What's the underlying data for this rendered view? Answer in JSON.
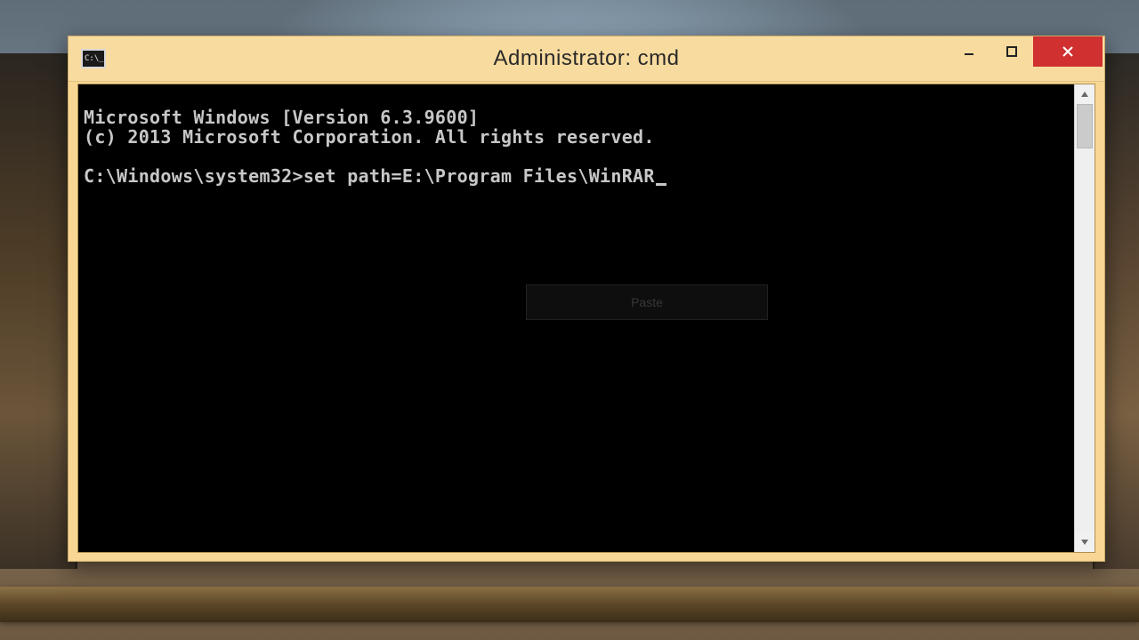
{
  "window": {
    "title": "Administrator: cmd",
    "controls": {
      "minimize_glyph": "—",
      "maximize_glyph": "▭",
      "close_glyph": "✕"
    },
    "icon_name": "cmd-icon"
  },
  "console": {
    "line1": "Microsoft Windows [Version 6.3.9600]",
    "line2": "(c) 2013 Microsoft Corporation. All rights reserved.",
    "blank": "",
    "prompt_prefix": "C:\\Windows\\system32>",
    "typed_command": "set path=E:\\Program Files\\WinRAR"
  },
  "faint_menu_label": "Paste"
}
